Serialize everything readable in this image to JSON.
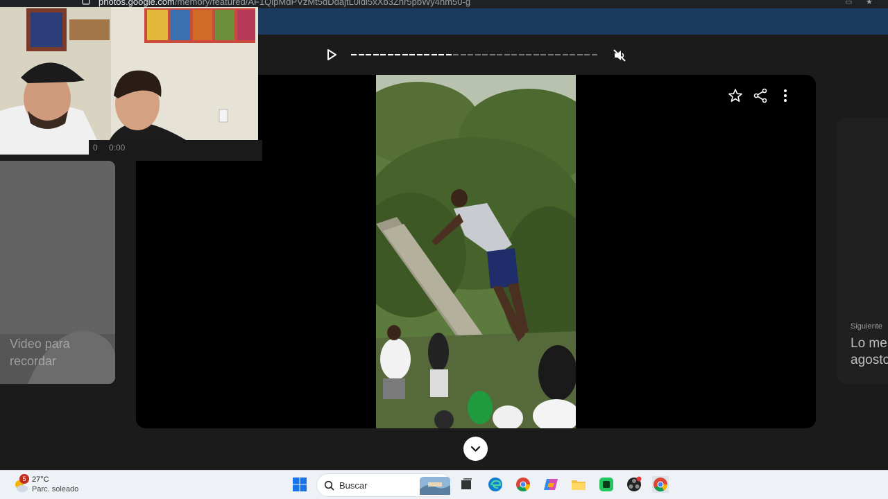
{
  "browser": {
    "url_host": "photos.google.com",
    "url_path": "/memory/featured/AF1QipMdPVzMt5dDdajtL0ldi5xXb3Zhr5pbWy4nm50-g"
  },
  "player": {
    "play_icon": "play-icon",
    "mute_icon": "volume-muted-icon",
    "progress": 0.4
  },
  "card": {
    "actions": [
      "star-icon",
      "share-icon",
      "more-vert-icon"
    ]
  },
  "previous_memory": {
    "title": "Video para recordar"
  },
  "next_memory": {
    "caption": "Siguiente",
    "title": "Lo me",
    "title_line2": "agosto"
  },
  "webcam": {
    "counter": "0",
    "time": "0:00"
  },
  "taskbar": {
    "weather_badge": "5",
    "weather_temp": "27°C",
    "weather_desc": "Parc. soleado",
    "search_placeholder": "Buscar",
    "apps": [
      "windows-start-icon",
      "task-view-icon",
      "edge-icon",
      "chrome-icon",
      "copilot-icon",
      "file-explorer-icon",
      "app-icon",
      "obs-icon",
      "chrome-active-icon"
    ]
  },
  "colors": {
    "accent_blue": "#1c3a5e",
    "background": "#1b1b1b",
    "taskbar": "#eef1f6"
  }
}
